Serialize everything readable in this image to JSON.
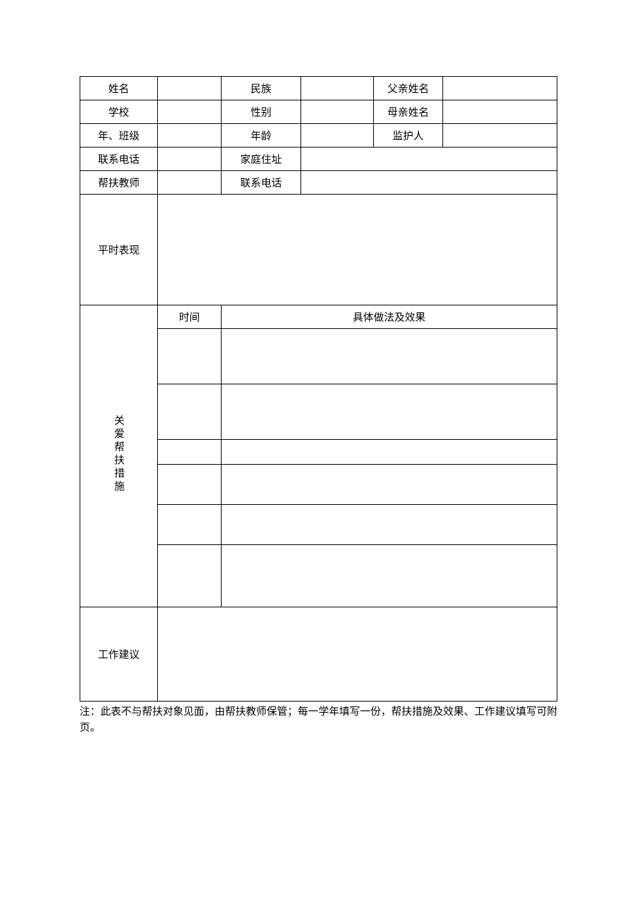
{
  "rows": {
    "r1": {
      "label1": "姓名",
      "label2": "民族",
      "label3": "父亲姓名",
      "val1": "",
      "val2": "",
      "val3": ""
    },
    "r2": {
      "label1": "学校",
      "label2": "性别",
      "label3": "母亲姓名",
      "val1": "",
      "val2": "",
      "val3": ""
    },
    "r3": {
      "label1": "年、班级",
      "label2": "年龄",
      "label3": "监护人",
      "val1": "",
      "val2": "",
      "val3": ""
    },
    "r4": {
      "label1": "联系电话",
      "label2": "家庭住址",
      "val1": "",
      "val2": ""
    },
    "r5": {
      "label1": "帮扶教师",
      "label2": "联系电话",
      "val1": "",
      "val2": ""
    }
  },
  "performance": {
    "label": "平时表现",
    "value": ""
  },
  "measures": {
    "label": "关爱帮扶措施",
    "time_header": "时间",
    "method_header": "具体做法及效果",
    "entries": [
      {
        "time": "",
        "method": ""
      },
      {
        "time": "",
        "method": ""
      },
      {
        "time": "",
        "method": ""
      },
      {
        "time": "",
        "method": ""
      },
      {
        "time": "",
        "method": ""
      },
      {
        "time": "",
        "method": ""
      }
    ]
  },
  "suggestions": {
    "label": "工作建议",
    "value": ""
  },
  "note": "注：此表不与帮扶对象见面，由帮扶教师保管；每一学年填写一份，帮扶措施及效果、工作建议填写可附页。"
}
